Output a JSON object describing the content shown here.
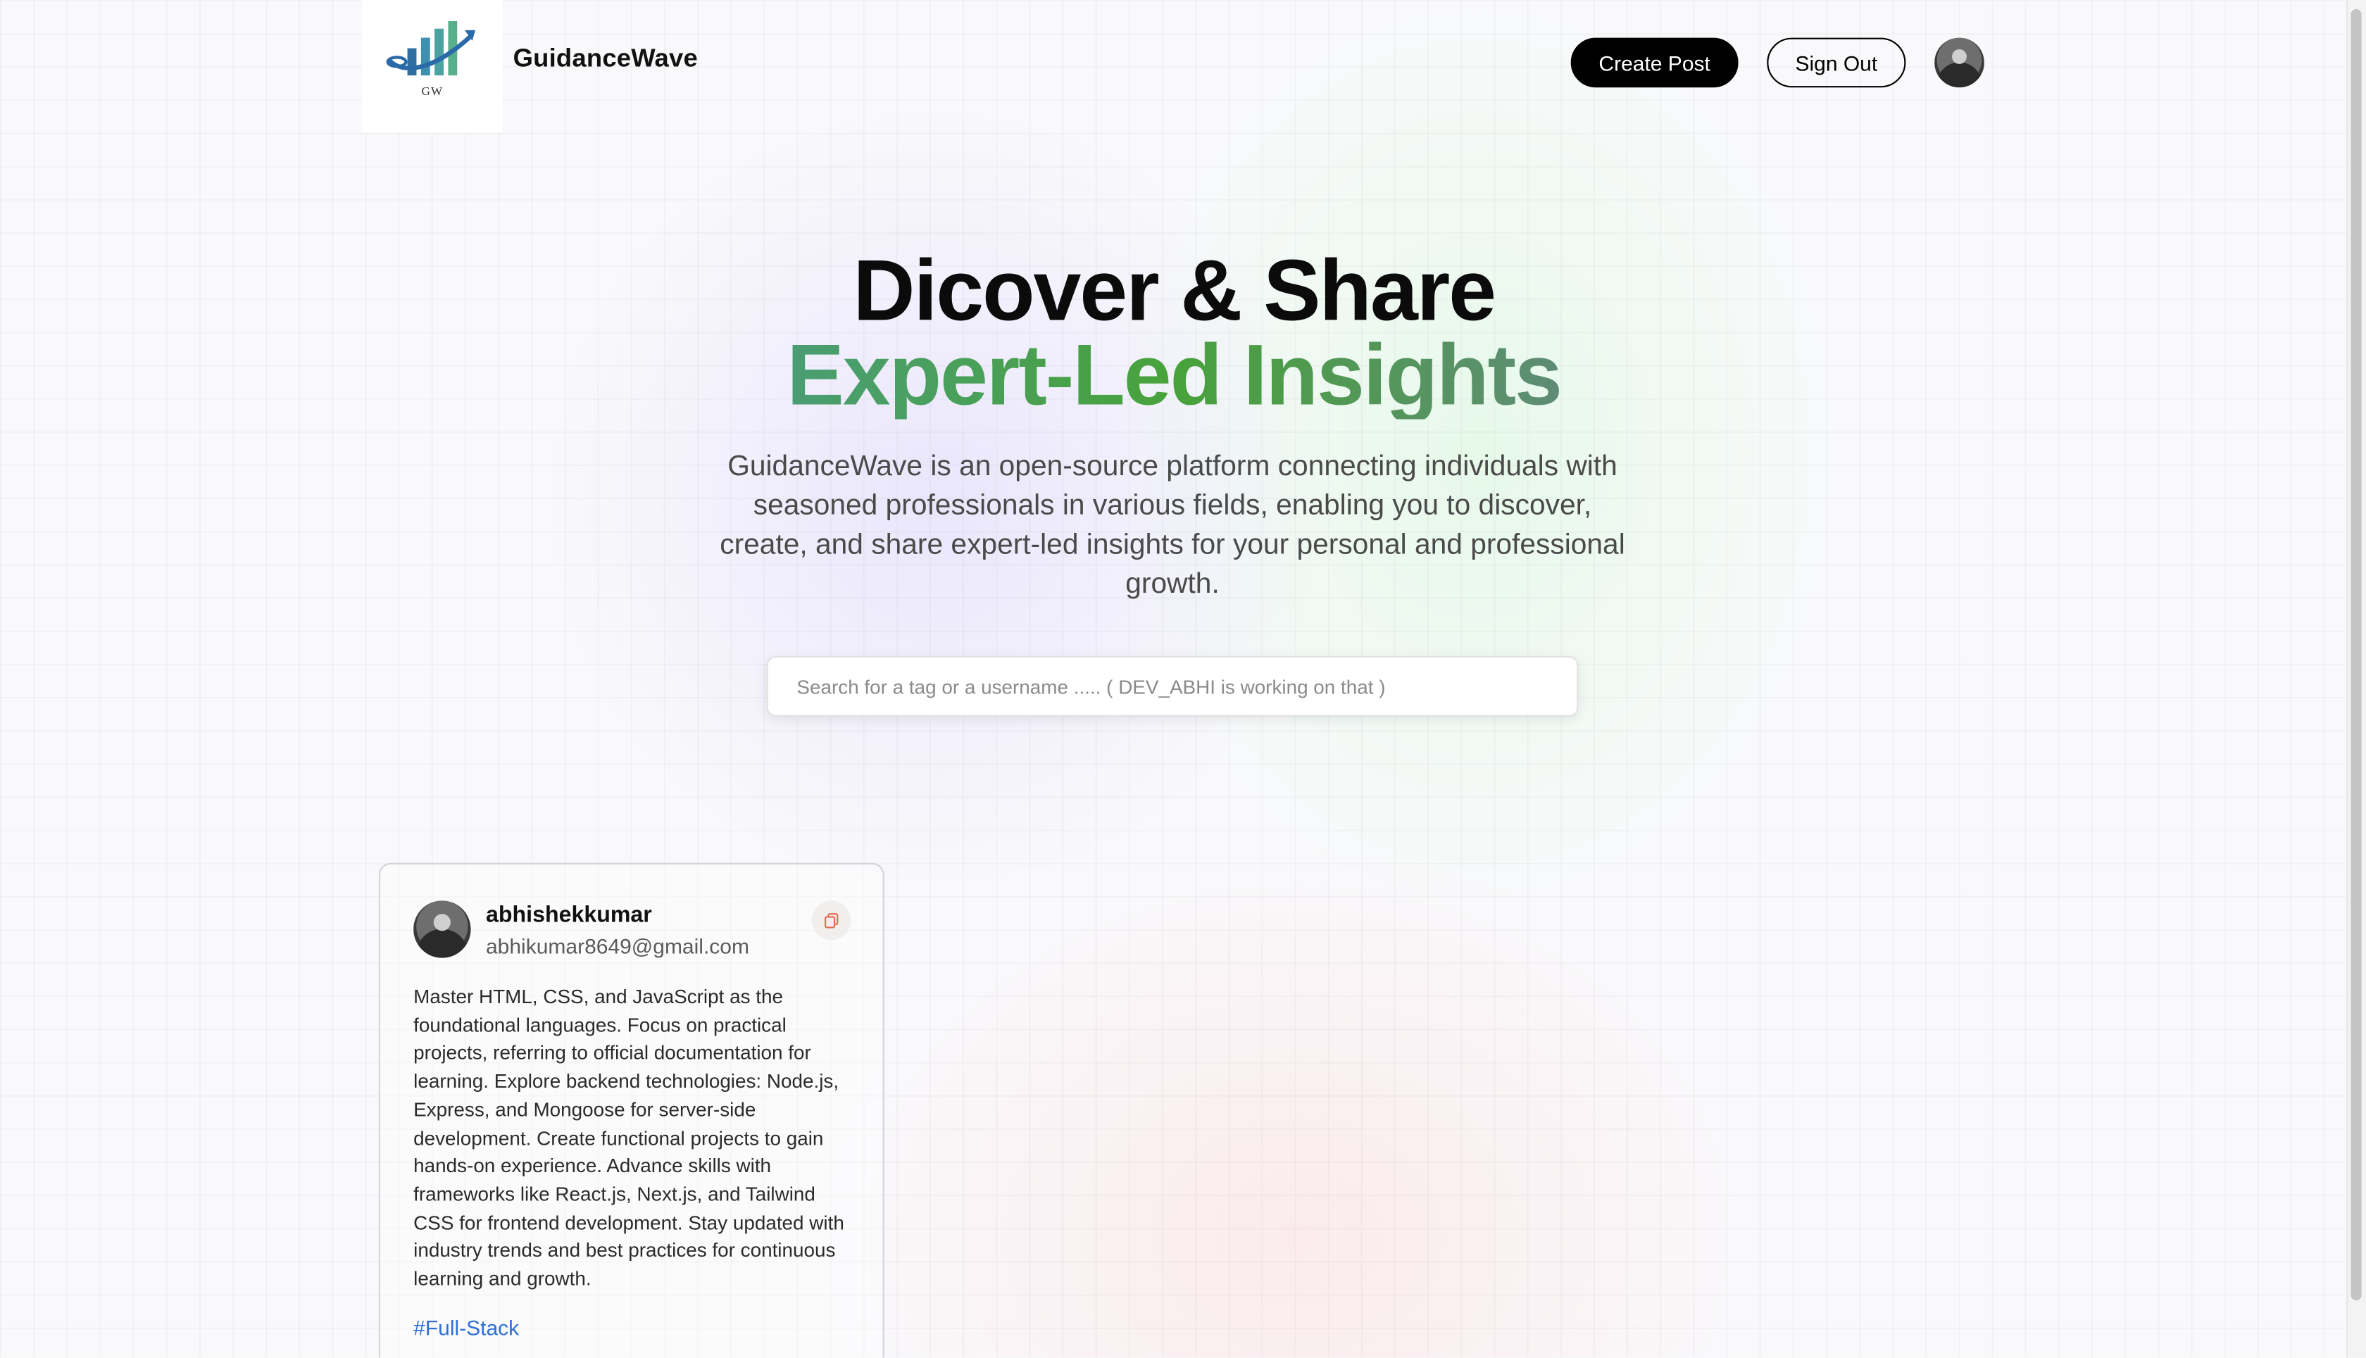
{
  "header": {
    "logo_text": "GW",
    "brand_name": "GuidanceWave",
    "create_post_label": "Create Post",
    "sign_out_label": "Sign Out"
  },
  "hero": {
    "title_line1": "Dicover & Share",
    "title_line2": "Expert-Led Insights",
    "description": "GuidanceWave is an open-source platform connecting individuals with seasoned professionals in various fields, enabling you to discover, create, and share expert-led insights for your personal and professional growth."
  },
  "search": {
    "placeholder": "Search for a tag or a username ..... ( DEV_ABHI is working on that )",
    "value": ""
  },
  "posts": [
    {
      "username": "abhishekkumar",
      "email": "abhikumar8649@gmail.com",
      "body": "Master HTML, CSS, and JavaScript as the foundational languages. Focus on practical projects, referring to official documentation for learning. Explore backend technologies: Node.js, Express, and Mongoose for server-side development. Create functional projects to gain hands-on experience. Advance skills with frameworks like React.js, Next.js, and Tailwind CSS for frontend development. Stay updated with industry trends and best practices for continuous learning and growth.",
      "tag": "#Full-Stack"
    }
  ],
  "colors": {
    "primary_button": "#000000",
    "tag_link": "#2f6fd6",
    "gradient_blue": "#3b7be0",
    "gradient_green": "#48a23b",
    "gradient_purple": "#a656de"
  }
}
